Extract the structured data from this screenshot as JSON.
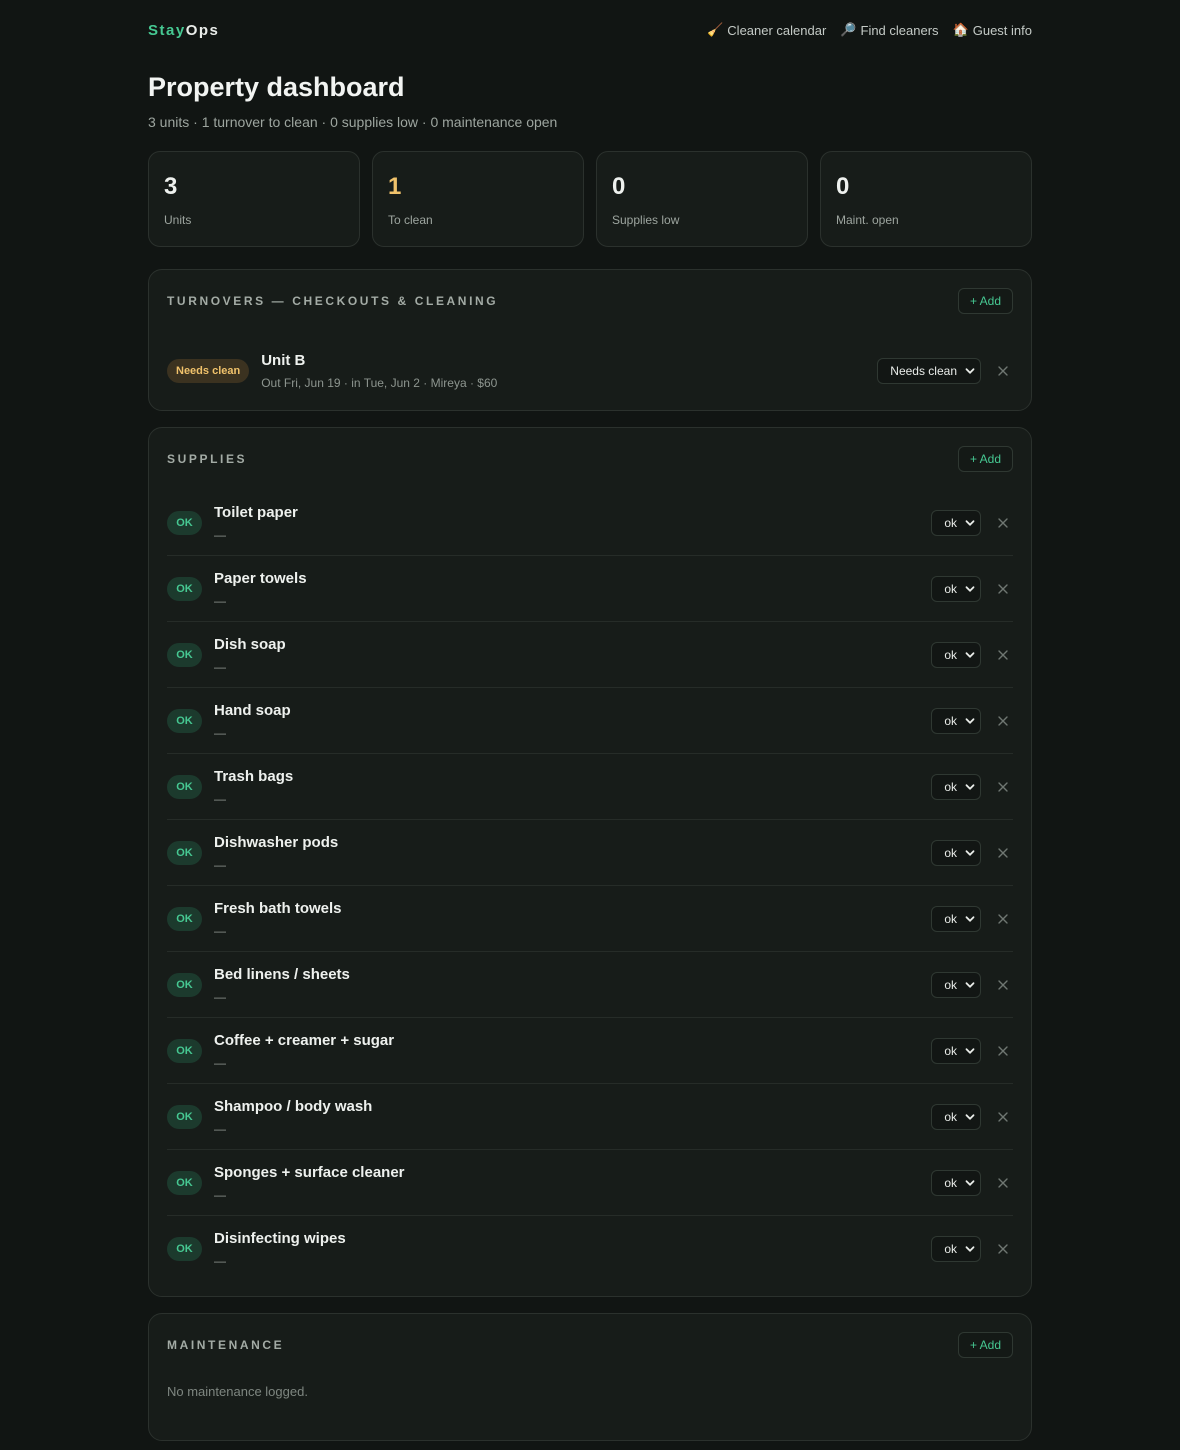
{
  "brand": {
    "part1": "Stay",
    "part2": "Ops"
  },
  "nav": [
    {
      "icon": "🧹",
      "label": "Cleaner calendar",
      "name": "nav-cleaner-calendar"
    },
    {
      "icon": "🔎",
      "label": "Find cleaners",
      "name": "nav-find-cleaners"
    },
    {
      "icon": "🏠",
      "label": "Guest info",
      "name": "nav-guest-info"
    }
  ],
  "header": {
    "title": "Property dashboard",
    "subtitle": "3 units · 1 turnover to clean · 0 supplies low · 0 maintenance open"
  },
  "stats": [
    {
      "value": "3",
      "label": "Units",
      "warn": false
    },
    {
      "value": "1",
      "label": "To clean",
      "warn": true
    },
    {
      "value": "0",
      "label": "Supplies low",
      "warn": false
    },
    {
      "value": "0",
      "label": "Maint. open",
      "warn": false
    }
  ],
  "turnovers": {
    "title": "TURNOVERS — CHECKOUTS & CLEANING",
    "add_label": "+ Add",
    "items": [
      {
        "badge": "Needs clean",
        "unit": "Unit B",
        "meta": "Out Fri, Jun 19 · in Tue, Jun 2 · Mireya · $60",
        "status": "Needs clean"
      }
    ]
  },
  "supplies": {
    "title": "SUPPLIES",
    "add_label": "+ Add",
    "items": [
      {
        "badge": "OK",
        "name": "Toilet paper",
        "meta": "—",
        "status": "ok"
      },
      {
        "badge": "OK",
        "name": "Paper towels",
        "meta": "—",
        "status": "ok"
      },
      {
        "badge": "OK",
        "name": "Dish soap",
        "meta": "—",
        "status": "ok"
      },
      {
        "badge": "OK",
        "name": "Hand soap",
        "meta": "—",
        "status": "ok"
      },
      {
        "badge": "OK",
        "name": "Trash bags",
        "meta": "—",
        "status": "ok"
      },
      {
        "badge": "OK",
        "name": "Dishwasher pods",
        "meta": "—",
        "status": "ok"
      },
      {
        "badge": "OK",
        "name": "Fresh bath towels",
        "meta": "—",
        "status": "ok"
      },
      {
        "badge": "OK",
        "name": "Bed linens / sheets",
        "meta": "—",
        "status": "ok"
      },
      {
        "badge": "OK",
        "name": "Coffee + creamer + sugar",
        "meta": "—",
        "status": "ok"
      },
      {
        "badge": "OK",
        "name": "Shampoo / body wash",
        "meta": "—",
        "status": "ok"
      },
      {
        "badge": "OK",
        "name": "Sponges + surface cleaner",
        "meta": "—",
        "status": "ok"
      },
      {
        "badge": "OK",
        "name": "Disinfecting wipes",
        "meta": "—",
        "status": "ok"
      }
    ]
  },
  "maintenance": {
    "title": "MAINTENANCE",
    "add_label": "+ Add",
    "empty": "No maintenance logged."
  },
  "colors": {
    "accent": "#46c892",
    "warn": "#f0c26b",
    "bg": "#111513",
    "card": "#171c19"
  }
}
